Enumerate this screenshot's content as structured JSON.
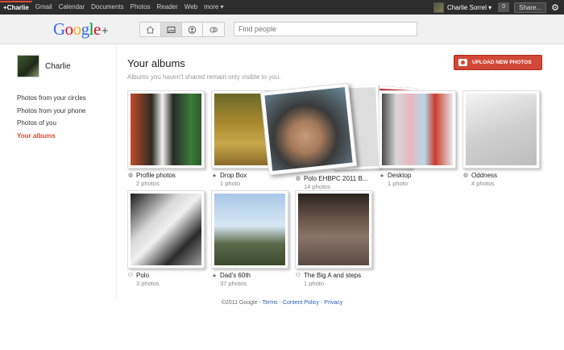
{
  "topbar": {
    "nav": [
      "+Charlie",
      "Gmail",
      "Calendar",
      "Documents",
      "Photos",
      "Reader",
      "Web",
      "more ▾"
    ],
    "user_name": "Charlie Sorrel ▾",
    "notification_count": "0",
    "share_label": "Share...",
    "colors": {
      "background": "#2d2d2d",
      "accent": "#dd4b39"
    }
  },
  "header": {
    "logo_text": "Google",
    "logo_plus": "+",
    "tabs": [
      "home-icon",
      "photos-icon",
      "profile-icon",
      "circles-icon"
    ],
    "search_placeholder": "Find people"
  },
  "sidebar": {
    "profile_name": "Charlie",
    "links": [
      {
        "label": "Photos from your circles",
        "active": false
      },
      {
        "label": "Photos from your phone",
        "active": false
      },
      {
        "label": "Photos of you",
        "active": false
      },
      {
        "label": "Your albums",
        "active": true
      }
    ]
  },
  "main": {
    "title": "Your albums",
    "subtitle": "Albums you haven't shared remain only visible to you.",
    "upload_label": "UPLOAD NEW PHOTOS",
    "albums": [
      {
        "name": "Profile photos",
        "count": "2 photos",
        "icon": "public-icon"
      },
      {
        "name": "Drop Box",
        "count": "1 photo",
        "icon": "lock-icon"
      },
      {
        "name": "Polo EHBPC 2011 B...",
        "count": "14 photos",
        "icon": "public-icon"
      },
      {
        "name": "Desktop",
        "count": "1 photo",
        "icon": "lock-icon"
      },
      {
        "name": "Oddness",
        "count": "4 photos",
        "icon": "public-icon"
      },
      {
        "name": "Polo",
        "count": "3 photos",
        "icon": "circles-icon"
      },
      {
        "name": "Dad's 60th",
        "count": "37 photos",
        "icon": "lock-icon"
      },
      {
        "name": "The Big A and steps",
        "count": "1 photo",
        "icon": "circles-icon"
      }
    ]
  },
  "footer": {
    "copyright": "©2011 Google",
    "sep1": " - ",
    "terms": "Terms",
    "sep2": " - ",
    "policy": "Content Policy",
    "sep3": " - ",
    "privacy": "Privacy"
  }
}
